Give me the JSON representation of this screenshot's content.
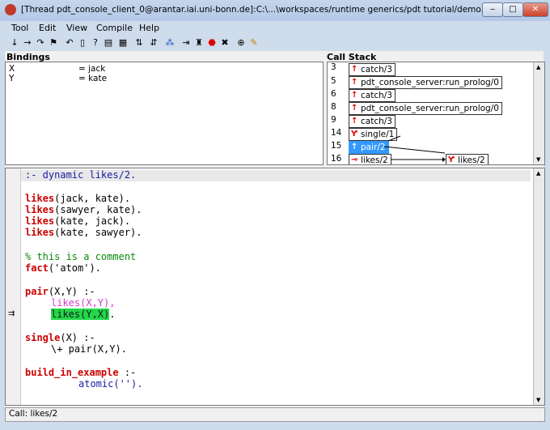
{
  "window": {
    "title": "[Thread pdt_console_client_0@arantar.iai.uni-bonn.de]:C:\\...\\workspaces/runtime generics/pdt tutorial/demo.pl",
    "controls": [
      "minimize",
      "maximize",
      "close"
    ]
  },
  "menu": [
    "Tool",
    "Edit",
    "View",
    "Compile",
    "Help"
  ],
  "toolbar": [
    "step-into-icon",
    "step-over-icon",
    "skip-icon",
    "finish-icon",
    "retry-icon",
    "nodebug-icon",
    "abort-icon",
    "break-icon",
    "up-icon",
    "down-icon",
    "find-icon",
    "butterfly-icon",
    "spy-icon",
    "leap-icon",
    "stop-icon",
    "query-icon",
    "zoom-icon",
    "edit-icon"
  ],
  "bindings": {
    "label": "Bindings",
    "rows": [
      {
        "name": "X",
        "value": "= jack"
      },
      {
        "name": "Y",
        "value": "= kate"
      }
    ]
  },
  "call_stack": {
    "label": "Call Stack",
    "frames": [
      {
        "num": "3",
        "goal": "catch/3"
      },
      {
        "num": "5",
        "goal": "pdt_console_server:run_prolog/0"
      },
      {
        "num": "6",
        "goal": "catch/3"
      },
      {
        "num": "8",
        "goal": "pdt_console_server:run_prolog/0"
      },
      {
        "num": "9",
        "goal": "catch/3"
      },
      {
        "num": "14",
        "goal": "single/1"
      },
      {
        "num": "15",
        "goal": "pair/2"
      },
      {
        "num": "16",
        "goal": "likes/2"
      }
    ],
    "side_goal": "likes/2"
  },
  "source": {
    "line1": ":- dynamic likes/2.",
    "facts": [
      {
        "name": "likes",
        "args": "(jack, kate)."
      },
      {
        "name": "likes",
        "args": "(sawyer, kate)."
      },
      {
        "name": "likes",
        "args": "(kate, jack)."
      },
      {
        "name": "likes",
        "args": "(kate, sawyer)."
      }
    ],
    "comment": "% this is a comment",
    "fact_name": "fact",
    "fact_args": "('atom').",
    "pair_head": "pair",
    "pair_args": "(X,Y) :-",
    "pair_body1": "likes(X,Y),",
    "pair_body2": "likes(Y,X)",
    "pair_body2_end": ".",
    "single_head": "single",
    "single_args": "(X) :-",
    "single_body": "\\+ pair(X,Y).",
    "build_head": "build_in_example",
    "build_tail": " :-",
    "build_body": "atomic('')."
  },
  "status": "Call: likes/2"
}
